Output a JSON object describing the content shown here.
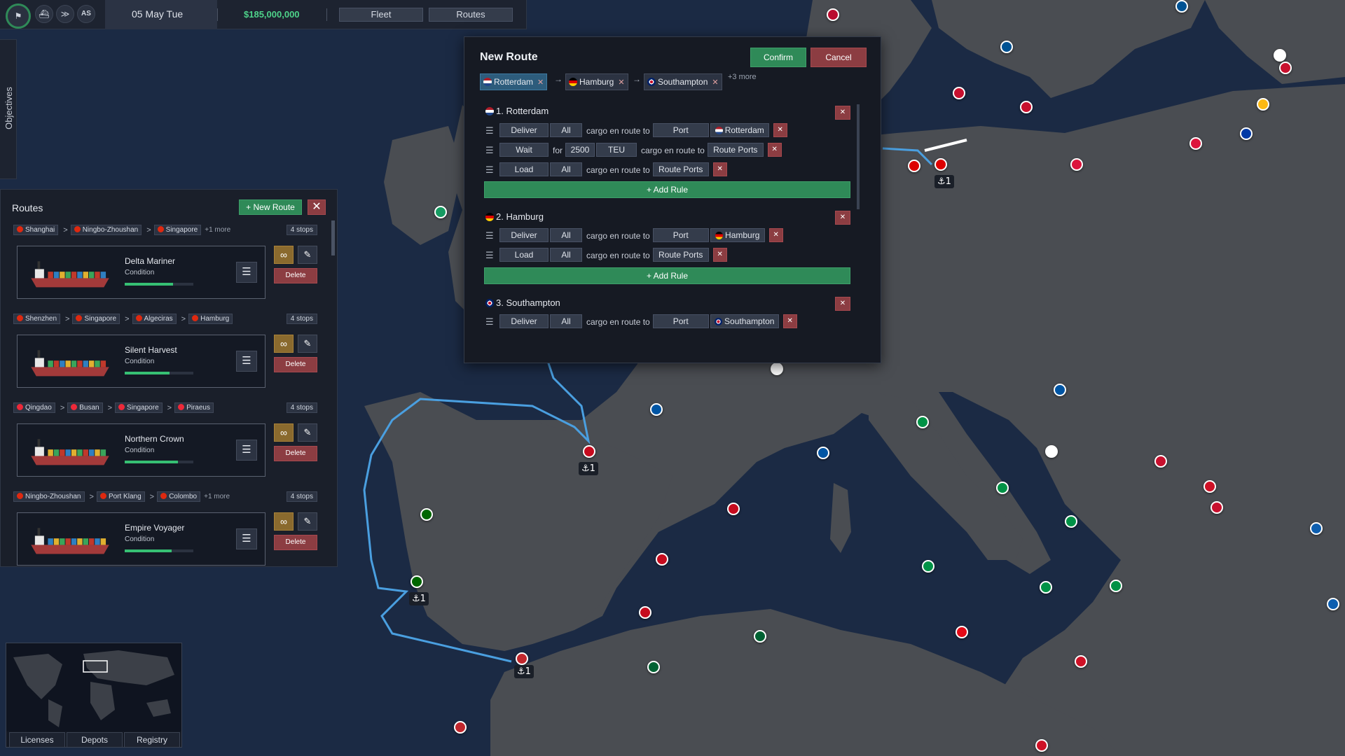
{
  "topbar": {
    "date": "05 May Tue",
    "money": "$185,000,000",
    "fleet_label": "Fleet",
    "routes_label": "Routes",
    "avatar_label": "AS"
  },
  "objectives": {
    "label": "Objectives"
  },
  "routes_panel": {
    "title": "Routes",
    "new_route_label": "+ New Route",
    "close_icon": "close-icon",
    "routes": [
      {
        "stops": [
          "Shanghai",
          "Ningbo-Zhoushan",
          "Singapore"
        ],
        "more": "+1 more",
        "count": "4 stops",
        "ship": "Delta Mariner",
        "condition_label": "Condition",
        "condition": 0.7,
        "delete_label": "Delete"
      },
      {
        "stops": [
          "Shenzhen",
          "Singapore",
          "Algeciras",
          "Hamburg"
        ],
        "more": "",
        "count": "4 stops",
        "ship": "Silent Harvest",
        "condition_label": "Condition",
        "condition": 0.65,
        "delete_label": "Delete"
      },
      {
        "stops": [
          "Qingdao",
          "Busan",
          "Singapore",
          "Piraeus"
        ],
        "more": "",
        "count": "4 stops",
        "ship": "Northern Crown",
        "condition_label": "Condition",
        "condition": 0.78,
        "delete_label": "Delete"
      },
      {
        "stops": [
          "Ningbo-Zhoushan",
          "Port Klang",
          "Colombo"
        ],
        "more": "+1 more",
        "count": "4 stops",
        "ship": "Empire Voyager",
        "condition_label": "Condition",
        "condition": 0.68,
        "delete_label": "Delete"
      }
    ]
  },
  "minimap": {
    "tabs": [
      "Licenses",
      "Depots",
      "Registry"
    ]
  },
  "new_route": {
    "title": "New Route",
    "confirm_label": "Confirm",
    "cancel_label": "Cancel",
    "path": [
      "Rotterdam",
      "Hamburg",
      "Southampton"
    ],
    "path_more": "+3 more",
    "add_rule_label": "+ Add Rule",
    "stops": [
      {
        "title": "1. Rotterdam",
        "rules": [
          {
            "action": "Deliver",
            "qty": "All",
            "text": "cargo en route to",
            "target": "Port",
            "port": "Rotterdam"
          },
          {
            "action": "Wait",
            "for": "for",
            "amount": "2500",
            "unit": "TEU",
            "text": "cargo en route to",
            "target": "Route Ports"
          },
          {
            "action": "Load",
            "qty": "All",
            "text": "cargo en route to",
            "target": "Route Ports"
          }
        ]
      },
      {
        "title": "2. Hamburg",
        "rules": [
          {
            "action": "Deliver",
            "qty": "All",
            "text": "cargo en route to",
            "target": "Port",
            "port": "Hamburg"
          },
          {
            "action": "Load",
            "qty": "All",
            "text": "cargo en route to",
            "target": "Route Ports"
          }
        ]
      },
      {
        "title": "3. Southampton",
        "rules": [
          {
            "action": "Deliver",
            "qty": "All",
            "text": "cargo en route to",
            "target": "Port",
            "port": "Southampton"
          }
        ]
      }
    ]
  },
  "map": {
    "port_anchor_labels": [
      "⚓1",
      "⚓1",
      "⚓1",
      "⚓1"
    ]
  },
  "colors": {
    "sea": "#1b2a44",
    "land": "#4a4d52",
    "route_line": "#4a9fe0",
    "accent_green": "#2f8a58",
    "danger_red": "#8c3d42"
  }
}
